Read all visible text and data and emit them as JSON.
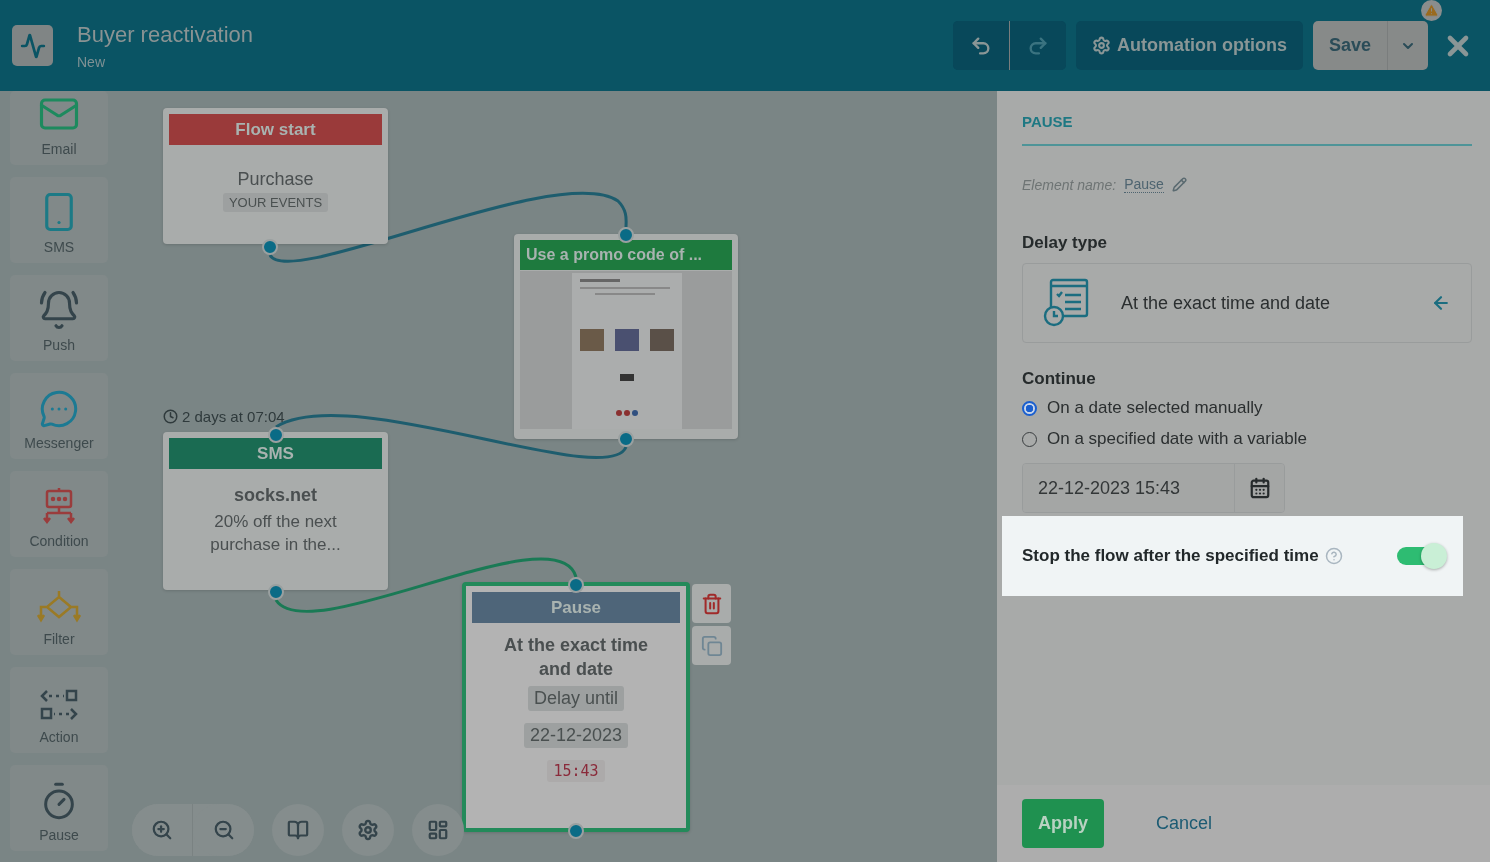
{
  "header": {
    "title": "Buyer reactivation",
    "subtitle": "New",
    "options_label": "Automation options",
    "save_label": "Save",
    "warning": true
  },
  "sidebar": {
    "items": [
      {
        "kind": "email",
        "label": "Email"
      },
      {
        "kind": "sms",
        "label": "SMS"
      },
      {
        "kind": "push",
        "label": "Push"
      },
      {
        "kind": "messenger",
        "label": "Messenger"
      },
      {
        "kind": "condition",
        "label": "Condition"
      },
      {
        "kind": "filter",
        "label": "Filter"
      },
      {
        "kind": "action",
        "label": "Action"
      },
      {
        "kind": "pause",
        "label": "Pause"
      }
    ]
  },
  "canvas": {
    "nodes": [
      {
        "kind": "start",
        "title": "Flow start",
        "selected": false,
        "lines": [
          "Purchase"
        ],
        "tag": "YOUR EVENTS"
      },
      {
        "kind": "email",
        "title": "Use a promo code of ...",
        "selected": false
      },
      {
        "kind": "sms",
        "title": "SMS",
        "selected": false,
        "timer": "2 days at 07:04",
        "lines": [
          "socks.net",
          "20% off the next purchase in the..."
        ]
      },
      {
        "kind": "pause",
        "title": "Pause",
        "selected": true,
        "lines": [
          "At the exact time and date"
        ],
        "tags": [
          "Delay until",
          "22-12-2023"
        ],
        "time": "15:43"
      }
    ]
  },
  "panel": {
    "heading": "PAUSE",
    "element_name_label": "Element name:",
    "element_name": "Pause",
    "delay_type_label": "Delay type",
    "delay_type_value": "At the exact time and date",
    "continue_label": "Continue",
    "options": [
      {
        "label": "On a date selected manually",
        "selected": true
      },
      {
        "label": "On a specified date with a variable",
        "selected": false
      }
    ],
    "date_value": "22-12-2023 15:43",
    "stop_flow": {
      "label": "Stop the flow after the specified time",
      "on": true
    },
    "apply": "Apply",
    "cancel": "Cancel"
  }
}
